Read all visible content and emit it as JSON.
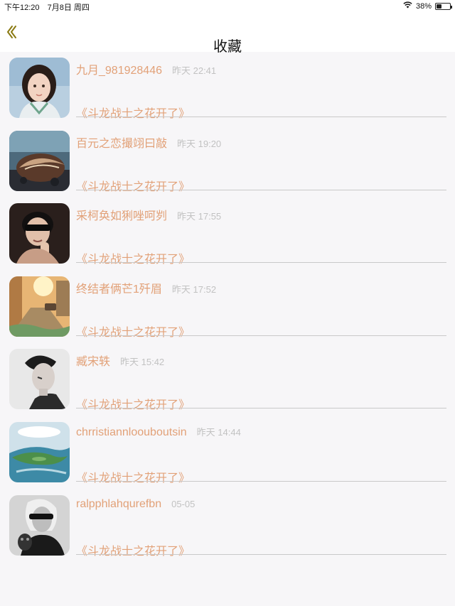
{
  "status_bar": {
    "time": "下午12:20",
    "date": "7月8日 周四",
    "battery": "38%",
    "battery_level": 0.38,
    "wifi_icon": "wifi-icon"
  },
  "nav": {
    "back_icon": "chevron-left-icon",
    "title": "收藏"
  },
  "items": [
    {
      "name": "九月_981928446",
      "time": "昨天 22:41",
      "book": "《斗龙战士之花开了》",
      "avatar": "girl-portrait"
    },
    {
      "name": "百元之恋撮翊曰敲",
      "time": "昨天 19:20",
      "book": "《斗龙战士之花开了》",
      "avatar": "seashell-photo"
    },
    {
      "name": "采柯奂如猁唑呵刿",
      "time": "昨天 17:55",
      "book": "《斗龙战士之花开了》",
      "avatar": "kid-sunglasses"
    },
    {
      "name": "终结者俩芒1歼眉",
      "time": "昨天 17:52",
      "book": "《斗龙战士之花开了》",
      "avatar": "sunset-street"
    },
    {
      "name": "臧宋轶",
      "time": "昨天 15:42",
      "book": "《斗龙战士之花开了》",
      "avatar": "bw-portrait"
    },
    {
      "name": "chrristiannloouboutsin",
      "time": "昨天 14:44",
      "book": "《斗龙战士之花开了》",
      "avatar": "island-landscape"
    },
    {
      "name": "ralpphlahqurefbn",
      "time": "05-05",
      "book": "《斗龙战士之花开了》",
      "avatar": "woman-sunglasses-cat"
    }
  ],
  "colors": {
    "accent": "#e2a178",
    "time_text": "#c2c2c2",
    "back_icon": "#8a7a12",
    "background": "#f7f6f8"
  }
}
